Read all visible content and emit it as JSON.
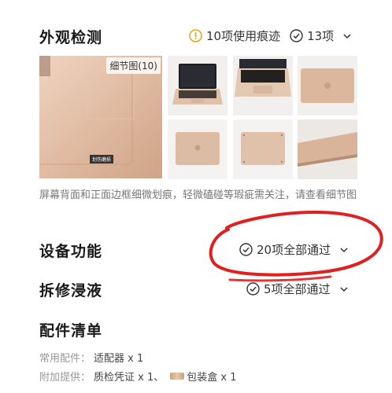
{
  "appearance": {
    "title": "外观检测",
    "wear_summary": "10项使用痕迹",
    "pass_summary": "13项",
    "gallery_badge": "细节图(10)",
    "photo_caption": "划伤磨损",
    "description": "屏幕背面和正面边框细微划痕，轻微磕碰等瑕疵需关注，请查看细节图"
  },
  "function": {
    "title": "设备功能",
    "summary": "20项全部通过"
  },
  "repair": {
    "title": "拆修浸液",
    "summary": "5项全部通过"
  },
  "accessories": {
    "title": "配件清单",
    "common_label": "常用配件：",
    "common_item": "适配器 x 1",
    "extra_label": "附加提供：",
    "extra_item1": "质检凭证 x 1、",
    "extra_item2": "包装盒 x 1"
  },
  "colors": {
    "warning": "#e8a317",
    "annotation_red": "#e02020"
  }
}
